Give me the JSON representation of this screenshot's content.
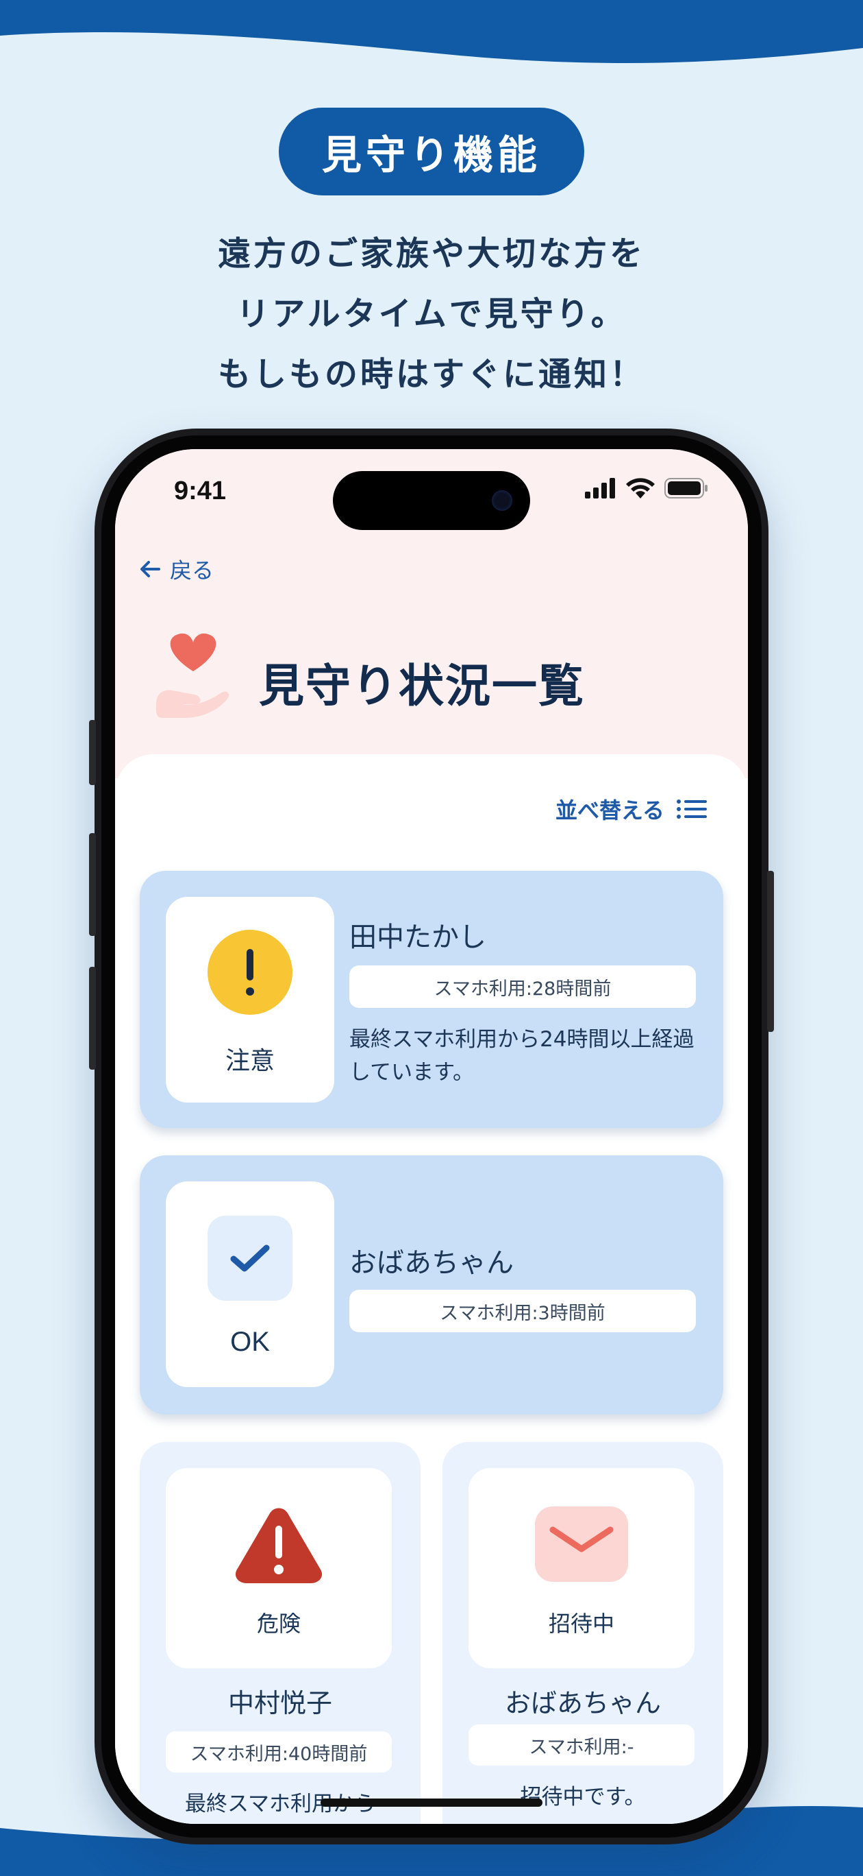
{
  "banner": {
    "feature_label": "見守り機能",
    "tagline_lines": [
      "遠方のご家族や大切な方を",
      "リアルタイムで見守り。",
      "もしもの時はすぐに通知！"
    ]
  },
  "status_bar": {
    "time": "9:41"
  },
  "nav": {
    "back_label": "戻る",
    "back_icon": "arrow-left-icon"
  },
  "header": {
    "title": "見守り状況一覧",
    "icon": "heart-hand-icon"
  },
  "toolbar": {
    "sort_label": "並べ替える",
    "sort_icon": "list-icon"
  },
  "members": [
    {
      "status": "注意",
      "status_icon": "exclamation-circle-icon",
      "name": "田中たかし",
      "usage": "スマホ利用:28時間前",
      "message": "最終スマホ利用から24時間以上経過しています。"
    },
    {
      "status": "OK",
      "status_icon": "check-icon",
      "name": "おばあちゃん",
      "usage": "スマホ利用:3時間前",
      "message": ""
    },
    {
      "status": "危険",
      "status_icon": "warning-triangle-icon",
      "name": "中村悦子",
      "usage": "スマホ利用:40時間前",
      "message": "最終スマホ利用から"
    },
    {
      "status": "招待中",
      "status_icon": "envelope-icon",
      "name": "おばあちゃん",
      "usage": "スマホ利用:-",
      "message": "招待中です。"
    }
  ],
  "colors": {
    "brand": "#105aa6",
    "card_blue": "#c9dff7",
    "card_light": "#eaf3fd",
    "caution": "#f8c534",
    "danger": "#c0392b",
    "heart": "#ec6a5e"
  }
}
